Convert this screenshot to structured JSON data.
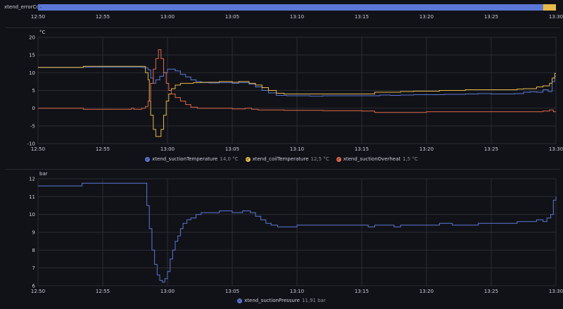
{
  "chart_data": [
    {
      "type": "state-timeline",
      "row_label": "xtend_errorCode",
      "states": [
        {
          "from": "12:50",
          "to": "13:29",
          "label": "-",
          "color": "#5b77d6"
        },
        {
          "from": "13:29",
          "to": "13:30",
          "label": "",
          "color": "#e5b94a"
        }
      ],
      "x_ticks": [
        "12:50",
        "12:55",
        "13:00",
        "13:05",
        "13:10",
        "13:15",
        "13:20",
        "13:25",
        "13:30"
      ]
    },
    {
      "type": "line",
      "step": true,
      "y_unit": "°C",
      "ylim": [
        -10,
        20
      ],
      "y_ticks": [
        "20",
        "15",
        "10",
        "5",
        "0",
        "-5",
        "-10"
      ],
      "x_ticks": [
        "12:50",
        "12:55",
        "13:00",
        "13:05",
        "13:10",
        "13:15",
        "13:20",
        "13:25",
        "13:30"
      ],
      "xlim_min": [
        0,
        40
      ],
      "grid": true,
      "series": [
        {
          "name": "xtend_suctionTemperature",
          "last": "14,0 °C",
          "color": "#5b77d6",
          "points": [
            [
              0,
              11.5
            ],
            [
              3.5,
              11.6
            ],
            [
              8,
              11.5
            ],
            [
              8.2,
              11.4
            ],
            [
              8.5,
              10.8
            ],
            [
              8.7,
              8.5
            ],
            [
              8.9,
              7
            ],
            [
              9.1,
              8
            ],
            [
              9.4,
              9
            ],
            [
              9.7,
              10
            ],
            [
              10,
              11
            ],
            [
              10.3,
              11
            ],
            [
              10.6,
              10.5
            ],
            [
              11,
              9.5
            ],
            [
              11.4,
              8.8
            ],
            [
              11.8,
              8
            ],
            [
              12.2,
              7.5
            ],
            [
              12.6,
              7.2
            ],
            [
              13.2,
              7.1
            ],
            [
              14,
              7.2
            ],
            [
              15,
              7
            ],
            [
              15.5,
              7.2
            ],
            [
              16.3,
              6.8
            ],
            [
              16.8,
              6
            ],
            [
              17.3,
              5
            ],
            [
              17.8,
              4.3
            ],
            [
              18.4,
              3.6
            ],
            [
              19.2,
              3.5
            ],
            [
              20,
              3.5
            ],
            [
              21,
              3.4
            ],
            [
              22,
              3.5
            ],
            [
              23,
              3.5
            ],
            [
              25.6,
              3.5
            ],
            [
              26.4,
              3.7
            ],
            [
              27.2,
              3.6
            ],
            [
              28,
              3.7
            ],
            [
              29,
              3.8
            ],
            [
              30,
              3.8
            ],
            [
              31.4,
              3.9
            ],
            [
              33,
              4
            ],
            [
              34,
              4.1
            ],
            [
              35,
              4
            ],
            [
              36.8,
              4.1
            ],
            [
              37.5,
              4.5
            ],
            [
              38,
              4.6
            ],
            [
              38.5,
              4.5
            ],
            [
              39,
              5.2
            ],
            [
              39.4,
              4.7
            ],
            [
              39.7,
              7.5
            ],
            [
              39.9,
              9
            ],
            [
              40,
              9
            ]
          ]
        },
        {
          "name": "xtend_coilTemperature",
          "last": "12,5 °C",
          "color": "#e5b94a",
          "points": [
            [
              0,
              11.5
            ],
            [
              3.5,
              11.8
            ],
            [
              8,
              11.8
            ],
            [
              8.3,
              10
            ],
            [
              8.5,
              8
            ],
            [
              8.6,
              2
            ],
            [
              8.7,
              -2
            ],
            [
              8.9,
              -6
            ],
            [
              9.1,
              -8
            ],
            [
              9.3,
              -8
            ],
            [
              9.5,
              -6
            ],
            [
              9.7,
              -2
            ],
            [
              9.9,
              2
            ],
            [
              10.1,
              4
            ],
            [
              10.3,
              5.5
            ],
            [
              10.6,
              6.5
            ],
            [
              11,
              7
            ],
            [
              11.4,
              7
            ],
            [
              12,
              7.2
            ],
            [
              12.6,
              7.3
            ],
            [
              13.5,
              7.3
            ],
            [
              14,
              7.5
            ],
            [
              15,
              7.3
            ],
            [
              15.5,
              7.5
            ],
            [
              16.3,
              7
            ],
            [
              16.8,
              6.5
            ],
            [
              17.3,
              5.8
            ],
            [
              17.8,
              5
            ],
            [
              18.4,
              4.2
            ],
            [
              19,
              4
            ],
            [
              22,
              4
            ],
            [
              25.2,
              4
            ],
            [
              26,
              4.5
            ],
            [
              27,
              4.5
            ],
            [
              28,
              4.7
            ],
            [
              29,
              4.8
            ],
            [
              30,
              4.8
            ],
            [
              31,
              5
            ],
            [
              32,
              5
            ],
            [
              33,
              5.2
            ],
            [
              34,
              5.2
            ],
            [
              35,
              5.2
            ],
            [
              36.5,
              5.2
            ],
            [
              37,
              5.4
            ],
            [
              37.5,
              5.5
            ],
            [
              38,
              5.5
            ],
            [
              38.5,
              6
            ],
            [
              39,
              6.3
            ],
            [
              39.5,
              7
            ],
            [
              39.7,
              8.5
            ],
            [
              39.9,
              9.8
            ],
            [
              40,
              9.8
            ]
          ]
        },
        {
          "name": "xtend_suctionOverheat",
          "last": "1,5 °C",
          "color": "#e0694a",
          "points": [
            [
              0,
              0
            ],
            [
              3,
              0
            ],
            [
              3.5,
              -0.3
            ],
            [
              7,
              -0.3
            ],
            [
              7.2,
              0
            ],
            [
              7.4,
              -0.3
            ],
            [
              8,
              0
            ],
            [
              8.3,
              0.5
            ],
            [
              8.5,
              2
            ],
            [
              8.7,
              7
            ],
            [
              8.9,
              11
            ],
            [
              9.1,
              14
            ],
            [
              9.3,
              16.5
            ],
            [
              9.5,
              14
            ],
            [
              9.7,
              10
            ],
            [
              9.9,
              7
            ],
            [
              10.1,
              5
            ],
            [
              10.3,
              4
            ],
            [
              10.6,
              3
            ],
            [
              11,
              2
            ],
            [
              11.4,
              1
            ],
            [
              11.8,
              0.3
            ],
            [
              12.3,
              0
            ],
            [
              14,
              0
            ],
            [
              15,
              -0.2
            ],
            [
              16,
              0
            ],
            [
              16.5,
              -0.3
            ],
            [
              17,
              -0.5
            ],
            [
              18,
              -0.5
            ],
            [
              19,
              -0.6
            ],
            [
              22,
              -0.7
            ],
            [
              25,
              -0.8
            ],
            [
              26,
              -1.2
            ],
            [
              30,
              -1
            ],
            [
              34,
              -1
            ],
            [
              38,
              -1
            ],
            [
              39,
              -0.8
            ],
            [
              39.5,
              -0.5
            ],
            [
              39.8,
              -1
            ],
            [
              40,
              -1
            ]
          ]
        }
      ]
    },
    {
      "type": "line",
      "step": true,
      "y_unit": "bar",
      "ylim": [
        6,
        12
      ],
      "y_ticks": [
        "12",
        "11",
        "10",
        "9",
        "8",
        "7",
        "6"
      ],
      "x_ticks": [
        "12:50",
        "12:55",
        "13:00",
        "13:05",
        "13:10",
        "13:15",
        "13:20",
        "13:25",
        "13:30"
      ],
      "xlim_min": [
        0,
        40
      ],
      "grid": true,
      "series": [
        {
          "name": "xtend_suctionPressure",
          "last": "11,91 bar",
          "color": "#5b77d6",
          "points": [
            [
              0,
              11.6
            ],
            [
              3.4,
              11.75
            ],
            [
              8.2,
              11.75
            ],
            [
              8.4,
              10.5
            ],
            [
              8.6,
              9.2
            ],
            [
              8.8,
              8
            ],
            [
              9,
              7.2
            ],
            [
              9.2,
              6.6
            ],
            [
              9.4,
              6.3
            ],
            [
              9.6,
              6.2
            ],
            [
              9.8,
              6.4
            ],
            [
              10,
              6.8
            ],
            [
              10.2,
              7.5
            ],
            [
              10.4,
              8
            ],
            [
              10.6,
              8.5
            ],
            [
              10.8,
              8.8
            ],
            [
              11,
              9.2
            ],
            [
              11.2,
              9.5
            ],
            [
              11.5,
              9.7
            ],
            [
              11.8,
              9.8
            ],
            [
              12.2,
              10
            ],
            [
              12.6,
              10.1
            ],
            [
              13.5,
              10.1
            ],
            [
              14,
              10.2
            ],
            [
              14.5,
              10.2
            ],
            [
              15,
              10.1
            ],
            [
              15.8,
              10.2
            ],
            [
              16.4,
              10.1
            ],
            [
              16.8,
              9.9
            ],
            [
              17.2,
              9.7
            ],
            [
              17.6,
              9.5
            ],
            [
              18,
              9.4
            ],
            [
              18.5,
              9.3
            ],
            [
              19.2,
              9.3
            ],
            [
              20,
              9.4
            ],
            [
              25.5,
              9.3
            ],
            [
              26,
              9.4
            ],
            [
              27,
              9.4
            ],
            [
              27.5,
              9.3
            ],
            [
              28,
              9.4
            ],
            [
              29,
              9.4
            ],
            [
              30,
              9.4
            ],
            [
              31,
              9.5
            ],
            [
              32,
              9.4
            ],
            [
              33,
              9.4
            ],
            [
              34,
              9.5
            ],
            [
              35,
              9.5
            ],
            [
              36,
              9.5
            ],
            [
              37,
              9.6
            ],
            [
              38,
              9.6
            ],
            [
              38.5,
              9.7
            ],
            [
              39,
              9.6
            ],
            [
              39.3,
              9.8
            ],
            [
              39.6,
              10
            ],
            [
              39.8,
              10.8
            ],
            [
              40,
              11
            ]
          ]
        }
      ]
    }
  ]
}
